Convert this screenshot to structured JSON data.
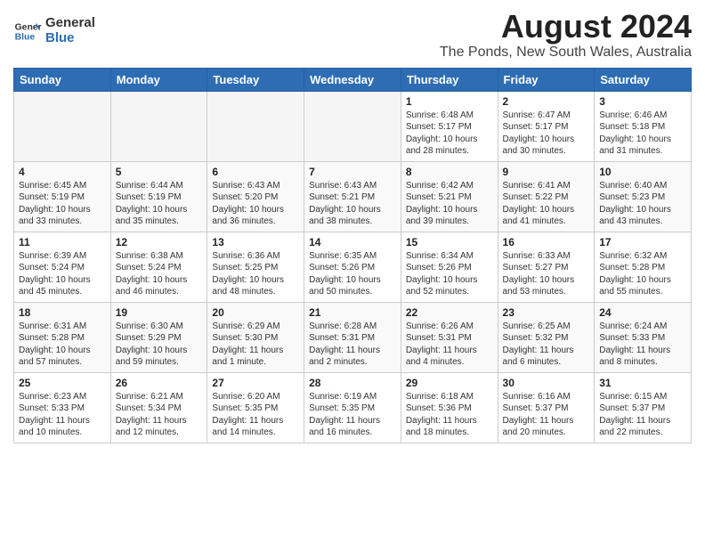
{
  "header": {
    "logo_line1": "General",
    "logo_line2": "Blue",
    "main_title": "August 2024",
    "subtitle": "The Ponds, New South Wales, Australia"
  },
  "weekdays": [
    "Sunday",
    "Monday",
    "Tuesday",
    "Wednesday",
    "Thursday",
    "Friday",
    "Saturday"
  ],
  "weeks": [
    [
      {
        "day": "",
        "info": ""
      },
      {
        "day": "",
        "info": ""
      },
      {
        "day": "",
        "info": ""
      },
      {
        "day": "",
        "info": ""
      },
      {
        "day": "1",
        "info": "Sunrise: 6:48 AM\nSunset: 5:17 PM\nDaylight: 10 hours\nand 28 minutes."
      },
      {
        "day": "2",
        "info": "Sunrise: 6:47 AM\nSunset: 5:17 PM\nDaylight: 10 hours\nand 30 minutes."
      },
      {
        "day": "3",
        "info": "Sunrise: 6:46 AM\nSunset: 5:18 PM\nDaylight: 10 hours\nand 31 minutes."
      }
    ],
    [
      {
        "day": "4",
        "info": "Sunrise: 6:45 AM\nSunset: 5:19 PM\nDaylight: 10 hours\nand 33 minutes."
      },
      {
        "day": "5",
        "info": "Sunrise: 6:44 AM\nSunset: 5:19 PM\nDaylight: 10 hours\nand 35 minutes."
      },
      {
        "day": "6",
        "info": "Sunrise: 6:43 AM\nSunset: 5:20 PM\nDaylight: 10 hours\nand 36 minutes."
      },
      {
        "day": "7",
        "info": "Sunrise: 6:43 AM\nSunset: 5:21 PM\nDaylight: 10 hours\nand 38 minutes."
      },
      {
        "day": "8",
        "info": "Sunrise: 6:42 AM\nSunset: 5:21 PM\nDaylight: 10 hours\nand 39 minutes."
      },
      {
        "day": "9",
        "info": "Sunrise: 6:41 AM\nSunset: 5:22 PM\nDaylight: 10 hours\nand 41 minutes."
      },
      {
        "day": "10",
        "info": "Sunrise: 6:40 AM\nSunset: 5:23 PM\nDaylight: 10 hours\nand 43 minutes."
      }
    ],
    [
      {
        "day": "11",
        "info": "Sunrise: 6:39 AM\nSunset: 5:24 PM\nDaylight: 10 hours\nand 45 minutes."
      },
      {
        "day": "12",
        "info": "Sunrise: 6:38 AM\nSunset: 5:24 PM\nDaylight: 10 hours\nand 46 minutes."
      },
      {
        "day": "13",
        "info": "Sunrise: 6:36 AM\nSunset: 5:25 PM\nDaylight: 10 hours\nand 48 minutes."
      },
      {
        "day": "14",
        "info": "Sunrise: 6:35 AM\nSunset: 5:26 PM\nDaylight: 10 hours\nand 50 minutes."
      },
      {
        "day": "15",
        "info": "Sunrise: 6:34 AM\nSunset: 5:26 PM\nDaylight: 10 hours\nand 52 minutes."
      },
      {
        "day": "16",
        "info": "Sunrise: 6:33 AM\nSunset: 5:27 PM\nDaylight: 10 hours\nand 53 minutes."
      },
      {
        "day": "17",
        "info": "Sunrise: 6:32 AM\nSunset: 5:28 PM\nDaylight: 10 hours\nand 55 minutes."
      }
    ],
    [
      {
        "day": "18",
        "info": "Sunrise: 6:31 AM\nSunset: 5:28 PM\nDaylight: 10 hours\nand 57 minutes."
      },
      {
        "day": "19",
        "info": "Sunrise: 6:30 AM\nSunset: 5:29 PM\nDaylight: 10 hours\nand 59 minutes."
      },
      {
        "day": "20",
        "info": "Sunrise: 6:29 AM\nSunset: 5:30 PM\nDaylight: 11 hours\nand 1 minute."
      },
      {
        "day": "21",
        "info": "Sunrise: 6:28 AM\nSunset: 5:31 PM\nDaylight: 11 hours\nand 2 minutes."
      },
      {
        "day": "22",
        "info": "Sunrise: 6:26 AM\nSunset: 5:31 PM\nDaylight: 11 hours\nand 4 minutes."
      },
      {
        "day": "23",
        "info": "Sunrise: 6:25 AM\nSunset: 5:32 PM\nDaylight: 11 hours\nand 6 minutes."
      },
      {
        "day": "24",
        "info": "Sunrise: 6:24 AM\nSunset: 5:33 PM\nDaylight: 11 hours\nand 8 minutes."
      }
    ],
    [
      {
        "day": "25",
        "info": "Sunrise: 6:23 AM\nSunset: 5:33 PM\nDaylight: 11 hours\nand 10 minutes."
      },
      {
        "day": "26",
        "info": "Sunrise: 6:21 AM\nSunset: 5:34 PM\nDaylight: 11 hours\nand 12 minutes."
      },
      {
        "day": "27",
        "info": "Sunrise: 6:20 AM\nSunset: 5:35 PM\nDaylight: 11 hours\nand 14 minutes."
      },
      {
        "day": "28",
        "info": "Sunrise: 6:19 AM\nSunset: 5:35 PM\nDaylight: 11 hours\nand 16 minutes."
      },
      {
        "day": "29",
        "info": "Sunrise: 6:18 AM\nSunset: 5:36 PM\nDaylight: 11 hours\nand 18 minutes."
      },
      {
        "day": "30",
        "info": "Sunrise: 6:16 AM\nSunset: 5:37 PM\nDaylight: 11 hours\nand 20 minutes."
      },
      {
        "day": "31",
        "info": "Sunrise: 6:15 AM\nSunset: 5:37 PM\nDaylight: 11 hours\nand 22 minutes."
      }
    ]
  ]
}
